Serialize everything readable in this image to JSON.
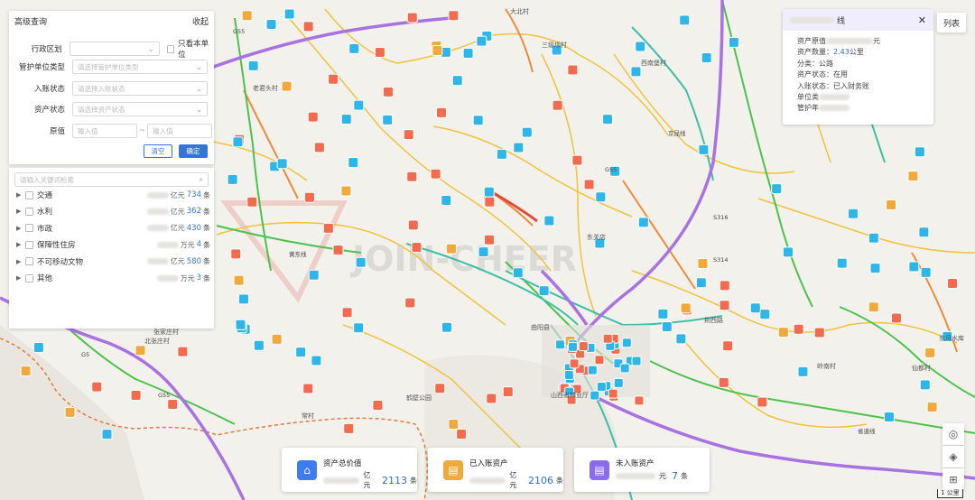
{
  "advanced": {
    "title": "高级查询",
    "collapse": "收起",
    "district_label": "行政区划",
    "only_unit_label": "只看本单位",
    "unit_type_label": "管护单位类型",
    "unit_type_placeholder": "请选择管护单位类型",
    "entry_label": "入账状态",
    "entry_placeholder": "请选择入账状态",
    "asset_label": "资产状态",
    "asset_placeholder": "请选择资产状态",
    "value_label": "原值",
    "value_min_placeholder": "输入值",
    "value_max_placeholder": "输入值",
    "value_sep": "~",
    "clear": "清空",
    "confirm": "确定"
  },
  "tree": {
    "search_placeholder": "请输入关键词检索",
    "items": [
      {
        "name": "交通",
        "unit": "亿元",
        "count": "734",
        "suffix": "条"
      },
      {
        "name": "水利",
        "unit": "亿元",
        "count": "362",
        "suffix": "条"
      },
      {
        "name": "市政",
        "unit": "亿元",
        "count": "430",
        "suffix": "条"
      },
      {
        "name": "保障性住房",
        "unit": "万元",
        "count": "4",
        "suffix": "条"
      },
      {
        "name": "不可移动文物",
        "unit": "亿元",
        "count": "580",
        "suffix": "条"
      },
      {
        "name": "其他",
        "unit": "万元",
        "count": "3",
        "suffix": "条"
      }
    ]
  },
  "info": {
    "title_suffix": "线",
    "close": "✕",
    "rows": [
      {
        "label": "资产原值",
        "value": "",
        "unit": "元"
      },
      {
        "label": "资产数量：",
        "value": "2.43",
        "unit": "公里",
        "highlight": true
      },
      {
        "label": "分类：",
        "value": "公路",
        "unit": ""
      },
      {
        "label": "资产状态：",
        "value": "在用",
        "unit": ""
      },
      {
        "label": "入账状态：",
        "value": "已入财务账",
        "unit": ""
      },
      {
        "label": "单位类",
        "value": "",
        "unit": ""
      },
      {
        "label": "管护年",
        "value": "",
        "unit": ""
      }
    ]
  },
  "list_button": "列表",
  "cards": [
    {
      "title": "资产总价值",
      "unit": "亿元",
      "count": "2113",
      "suffix": "条",
      "color": "#3d7cf0"
    },
    {
      "title": "已入账资产",
      "unit": "亿元",
      "count": "2106",
      "suffix": "条",
      "color": "#f2a93b"
    },
    {
      "title": "未入账资产",
      "unit": "元",
      "count": "7",
      "suffix": "条",
      "color": "#8b6cf0"
    }
  ],
  "map": {
    "watermark": "JOIN-CHEER",
    "places": [
      "大北村",
      "西南堡村",
      "三级坝村",
      "北张庄村",
      "老君头村",
      "张家庄村",
      "曲阳县",
      "山西省林业厅",
      "荆西路",
      "东关店",
      "仙都村",
      "东风水库",
      "常村",
      "岭南村",
      "鹤壁公园"
    ],
    "roads": [
      "黄东线",
      "S316",
      "G55",
      "G55",
      "G55",
      "S314",
      "G5",
      "京昆线",
      "省道线"
    ]
  },
  "scale": "1 公里",
  "colors": {
    "accent": "#3575d4",
    "card_blue": "#3d7cf0",
    "card_orange": "#f2a93b",
    "card_purple": "#8b6cf0"
  }
}
